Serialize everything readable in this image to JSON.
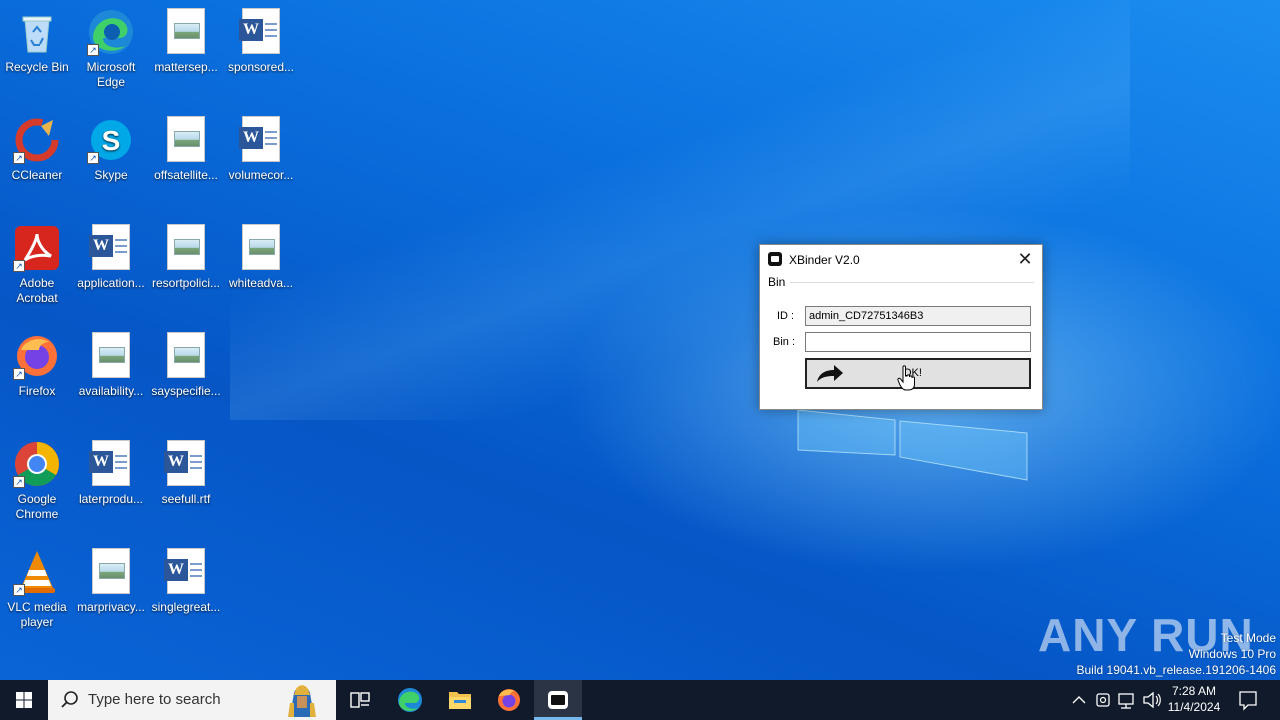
{
  "desktop": {
    "icons": [
      {
        "label": "Recycle Bin",
        "icon": "recycle-bin-icon"
      },
      {
        "label": "Microsoft Edge",
        "icon": "edge-icon"
      },
      {
        "label": "mattersep...",
        "icon": "image-file-icon"
      },
      {
        "label": "sponsored...",
        "icon": "word-doc-icon"
      },
      {
        "label": "CCleaner",
        "icon": "ccleaner-icon"
      },
      {
        "label": "Skype",
        "icon": "skype-icon"
      },
      {
        "label": "offsatellite...",
        "icon": "image-file-icon"
      },
      {
        "label": "volumecor...",
        "icon": "word-doc-icon"
      },
      {
        "label": "Adobe Acrobat",
        "icon": "acrobat-icon"
      },
      {
        "label": "application...",
        "icon": "word-doc-icon"
      },
      {
        "label": "resortpolici...",
        "icon": "image-file-icon"
      },
      {
        "label": "whiteadva...",
        "icon": "image-file-icon"
      },
      {
        "label": "Firefox",
        "icon": "firefox-icon"
      },
      {
        "label": "availability...",
        "icon": "image-file-icon"
      },
      {
        "label": "sayspecifie...",
        "icon": "image-file-icon"
      },
      {
        "label": "Google Chrome",
        "icon": "chrome-icon"
      },
      {
        "label": "laterprodu...",
        "icon": "word-doc-icon"
      },
      {
        "label": "seefull.rtf",
        "icon": "word-doc-icon"
      },
      {
        "label": "VLC media player",
        "icon": "vlc-icon"
      },
      {
        "label": "marprivacy...",
        "icon": "image-file-icon"
      },
      {
        "label": "singlegreat...",
        "icon": "word-doc-icon"
      }
    ]
  },
  "dialog": {
    "title": "XBinder V2.0",
    "close_glyph": "✕",
    "group_label": "Bin",
    "id_label": "ID :",
    "id_value": "admin_CD72751346B3",
    "bin_label": "Bin :",
    "bin_value": "",
    "ok_label": "OK!"
  },
  "watermark": {
    "brand": "ANY RUN",
    "line1": "Test Mode",
    "line2": "Windows 10 Pro",
    "line3": "Build 19041.vb_release.191206-1406"
  },
  "taskbar": {
    "search_placeholder": "Type here to search",
    "time": "7:28 AM",
    "date": "11/4/2024",
    "apps": [
      "task-view-icon",
      "edge-icon",
      "file-explorer-icon",
      "firefox-icon",
      "xbinder-icon"
    ]
  }
}
